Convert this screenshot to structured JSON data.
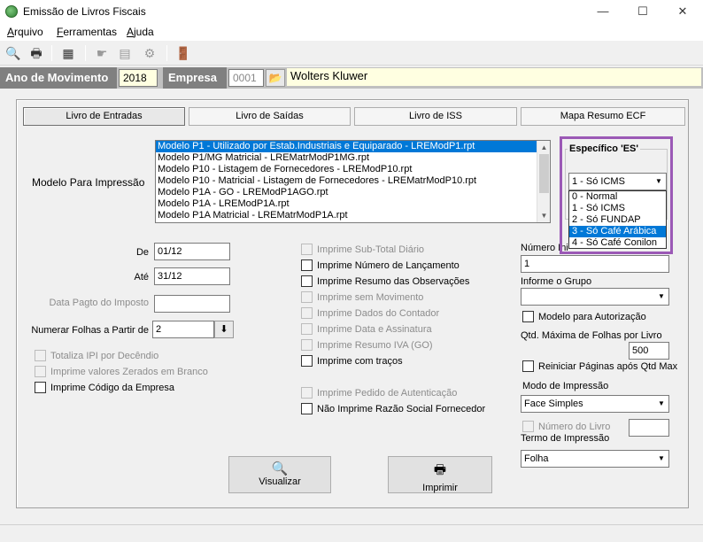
{
  "window": {
    "title": "Emissão de Livros Fiscais",
    "minimize": "—",
    "maximize": "☐",
    "close": "✕"
  },
  "menu": {
    "items": [
      "Arquivo",
      "Ferramentas",
      "Ajuda"
    ],
    "underline": [
      "A",
      "F",
      "A"
    ],
    "rest": [
      "rquivo",
      "erramentas",
      "juda"
    ]
  },
  "toolbar": {
    "icons": [
      "preview-icon",
      "print-icon",
      "report-icon",
      "hand-icon",
      "document-icon",
      "tools-icon",
      "exit-door-icon"
    ],
    "glyphs": [
      "🔍",
      "🖶",
      "▦",
      "☛",
      "▤",
      "⚙",
      "🚪"
    ]
  },
  "filter": {
    "ano_label": "Ano de Movimento",
    "ano_value": "2018",
    "empresa_label": "Empresa",
    "empresa_code": "0001",
    "folder_glyph": "📂",
    "empresa_name": "Wolters Kluwer"
  },
  "tabs": [
    "Livro de Entradas",
    "Livro de Saídas",
    "Livro de ISS",
    "Mapa Resumo ECF"
  ],
  "modelo": {
    "label": "Modelo Para Impressão",
    "items": [
      "Modelo P1 - Utilizado por Estab.Industriais e Equiparado - LREModP1.rpt",
      "Modelo P1/MG Matricial - LREMatrModP1MG.rpt",
      "Modelo P10 - Listagem de Fornecedores - LREModP10.rpt",
      "Modelo P10 - Matricial - Listagem de Fornecedores - LREMatrModP10.rpt",
      "Modelo P1A - GO - LREModP1AGO.rpt",
      "Modelo P1A - LREModP1A.rpt",
      "Modelo P1A Matricial - LREMatrModP1A.rpt"
    ],
    "selected_index": 0
  },
  "dates": {
    "de_label": "De",
    "de_value": "01/12",
    "ate_label": "Até",
    "ate_value": "31/12",
    "pagto_label": "Data Pagto do Imposto",
    "pagto_value": "",
    "folhas_label": "Numerar Folhas a Partir de",
    "folhas_value": "2",
    "folhas_btn_glyph": "⬇"
  },
  "left_checks": [
    {
      "label": "Totaliza IPI por Decêndio",
      "enabled": false
    },
    {
      "label": "Imprime valores Zerados em Branco",
      "enabled": false
    },
    {
      "label": "Imprime Código da Empresa",
      "enabled": true
    }
  ],
  "middle_checks": [
    {
      "label": "Imprime Sub-Total Diário",
      "enabled": false
    },
    {
      "label": "Imprime Número de Lançamento",
      "enabled": true
    },
    {
      "label": "Imprime Resumo das Observações",
      "enabled": true
    },
    {
      "label": "Imprime sem Movimento",
      "enabled": false
    },
    {
      "label": "Imprime Dados do Contador",
      "enabled": false
    },
    {
      "label": "Imprime Data e Assinatura",
      "enabled": false
    },
    {
      "label": "Imprime Resumo IVA (GO)",
      "enabled": false
    },
    {
      "label": "Imprime com traços",
      "enabled": true
    },
    {
      "label": "Imprime Pedido de Autenticação",
      "enabled": false
    },
    {
      "label": "Não Imprime Razão Social Fornecedor",
      "enabled": true
    }
  ],
  "especifico": {
    "title": "Específico 'ES'",
    "selected": "1 - Só ICMS",
    "options": [
      "0 - Normal",
      "1 - Só ICMS",
      "2 - Só FUNDAP",
      "3 - Só Café Arábica",
      "4 - Só Café Conilon"
    ],
    "highlighted_index": 3
  },
  "right": {
    "numero_label": "Número Ini",
    "numero_value": "1",
    "grupo_label": "Informe o Grupo",
    "grupo_value": "",
    "modelo_aut_label": "Modelo para Autorização",
    "qtd_label": "Qtd. Máxima de Folhas por Livro",
    "qtd_value": "500",
    "reiniciar_label": "Reiniciar Páginas após Qtd Max",
    "modo_label": "Modo de Impressão",
    "modo_value": "Face Simples",
    "numero_livro_label": "Número do Livro",
    "numero_livro_value": "",
    "termo_label": "Termo de Impressão",
    "termo_value": "Folha"
  },
  "buttons": {
    "visualizar": "Visualizar",
    "imprimir": "Imprimir",
    "visualizar_glyph": "🔍",
    "imprimir_glyph": "🖶"
  }
}
